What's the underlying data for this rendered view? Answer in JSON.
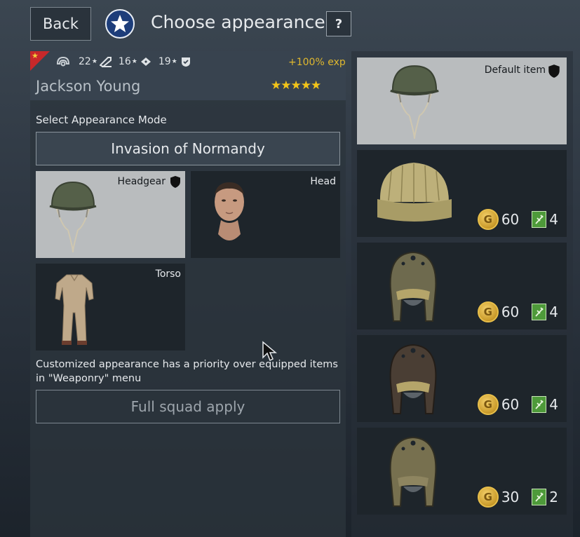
{
  "topbar": {
    "back_label": "Back",
    "title": "Choose appearance",
    "help_label": "?",
    "nation_icon": "us-star-roundel-icon"
  },
  "soldier": {
    "name": "Jackson Young",
    "exp_bonus": "+100% exp",
    "rating_stars": "★★★★★",
    "stats": [
      {
        "value": "22",
        "icon": "weapon-skill-icon"
      },
      {
        "value": "16",
        "icon": "agility-icon"
      },
      {
        "value": "19",
        "icon": "vitality-icon"
      }
    ],
    "stat_star": "★"
  },
  "appearance": {
    "mode_label": "Select Appearance Mode",
    "mode_value": "Invasion of Normandy",
    "slots": [
      {
        "label": "Headgear",
        "selected": true
      },
      {
        "label": "Head",
        "selected": false
      },
      {
        "label": "Torso",
        "selected": false
      }
    ],
    "priority_note": "Customized appearance has a priority over equipped items in \"Weaponry\" menu",
    "apply_label": "Full squad apply"
  },
  "items": [
    {
      "type": "m1-helmet",
      "default_label": "Default item"
    },
    {
      "type": "knit-cap",
      "gold": "60",
      "tickets": "4"
    },
    {
      "type": "tanker-helmet",
      "gold": "60",
      "tickets": "4"
    },
    {
      "type": "tanker-helmet-dark",
      "gold": "60",
      "tickets": "4"
    },
    {
      "type": "tanker-helmet-light",
      "gold": "30",
      "tickets": "2"
    }
  ],
  "colors": {
    "accent_gold": "#e0b82e",
    "selected_bg": "#b9bcbe",
    "card_bg": "#1e252b"
  }
}
